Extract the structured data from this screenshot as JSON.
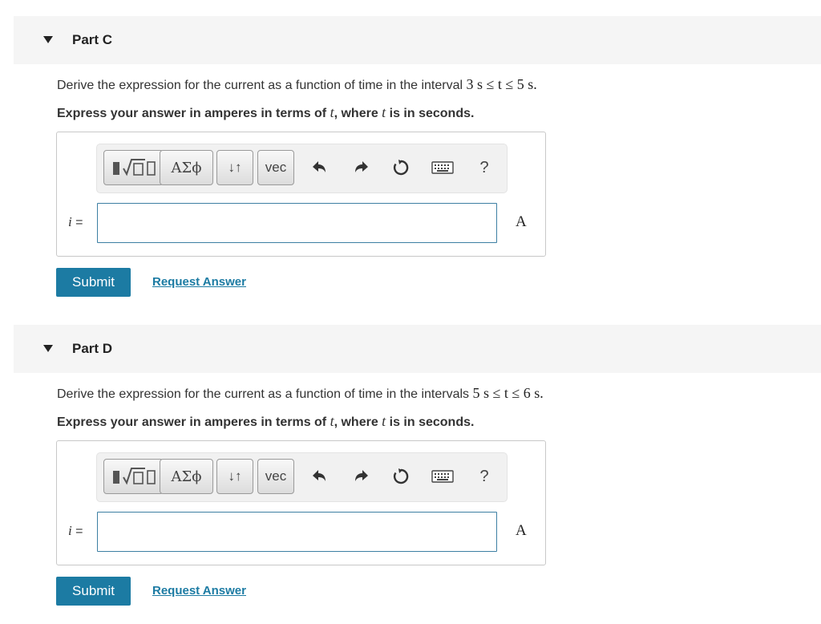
{
  "parts": [
    {
      "title": "Part C",
      "question_text": "Derive the expression for the current as a function of time in the interval ",
      "question_math": "3 s ≤ t ≤ 5 s.",
      "instruction_pre": "Express your answer in amperes in terms of ",
      "instruction_var": "t",
      "instruction_mid": ", where ",
      "instruction_var2": "t",
      "instruction_post": " is in seconds.",
      "toolbar": {
        "templates_icon": "templates-icon",
        "greek_label": "ΑΣϕ",
        "arrows_label": "↓↑",
        "vec_label": "vec",
        "help_label": "?"
      },
      "var_name": "i",
      "var_eq": " =",
      "answer_value": "",
      "unit": "A",
      "submit_label": "Submit",
      "request_label": "Request Answer"
    },
    {
      "title": "Part D",
      "question_text": "Derive the expression for the current as a function of time in the intervals ",
      "question_math": "5 s ≤ t ≤ 6 s.",
      "instruction_pre": "Express your answer in amperes in terms of ",
      "instruction_var": "t",
      "instruction_mid": ", where ",
      "instruction_var2": "t",
      "instruction_post": " is in seconds.",
      "toolbar": {
        "templates_icon": "templates-icon",
        "greek_label": "ΑΣϕ",
        "arrows_label": "↓↑",
        "vec_label": "vec",
        "help_label": "?"
      },
      "var_name": "i",
      "var_eq": " =",
      "answer_value": "",
      "unit": "A",
      "submit_label": "Submit",
      "request_label": "Request Answer"
    }
  ],
  "colors": {
    "accent": "#1c7ba3",
    "header_bg": "#f5f5f5",
    "input_border": "#3d7fa3"
  }
}
